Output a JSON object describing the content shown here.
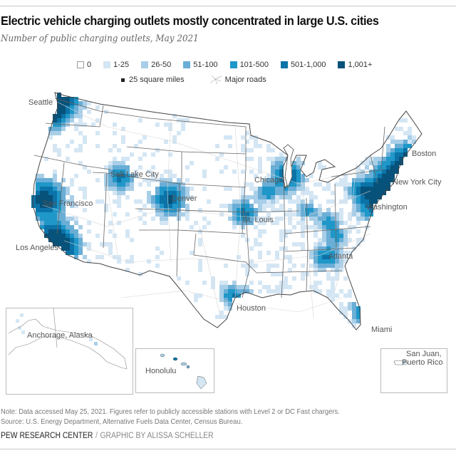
{
  "header": {
    "title": "Electric vehicle charging outlets mostly concentrated in large U.S. cities",
    "subtitle": "Number of public charging outlets, May 2021"
  },
  "legend": {
    "bins": [
      {
        "label": "0",
        "color": "#ffffff"
      },
      {
        "label": "1-25",
        "color": "#d4e6f4"
      },
      {
        "label": "26-50",
        "color": "#a9cfe8"
      },
      {
        "label": "51-100",
        "color": "#6aaed6"
      },
      {
        "label": "101-500",
        "color": "#1f97c8"
      },
      {
        "label": "501-1,000",
        "color": "#0b73a8"
      },
      {
        "label": "1,001+",
        "color": "#07527a"
      }
    ],
    "cell_size_label": "25 square miles",
    "roads_label": "Major roads"
  },
  "map": {
    "cities": [
      {
        "name": "Seattle"
      },
      {
        "name": "Salt Lake City"
      },
      {
        "name": "Denver"
      },
      {
        "name": "San Francisco"
      },
      {
        "name": "Los Angeles"
      },
      {
        "name": "Chicago"
      },
      {
        "name": "St. Louis"
      },
      {
        "name": "Boston"
      },
      {
        "name": "New York City"
      },
      {
        "name": "Washington"
      },
      {
        "name": "Atlanta"
      },
      {
        "name": "Houston"
      },
      {
        "name": "Miami"
      }
    ],
    "insets": {
      "alaska": "Anchorage, Alaska",
      "hawaii": "Honolulu",
      "pr_line1": "San Juan,",
      "pr_line2": "Puerto Rico"
    },
    "border_color": "#555555",
    "road_color": "#cfcfcf"
  },
  "footer": {
    "note": "Note: Data accessed May 25, 2021. Figures refer to publicly accessible stations with Level 2 or DC Fast chargers.",
    "source": "Source: U.S. Energy Department, Alternative Fuels Data Center, Census Bureau.",
    "org": "PEW RESEARCH CENTER",
    "separator": "/",
    "byline": "GRAPHIC BY ALISSA SCHELLER"
  }
}
